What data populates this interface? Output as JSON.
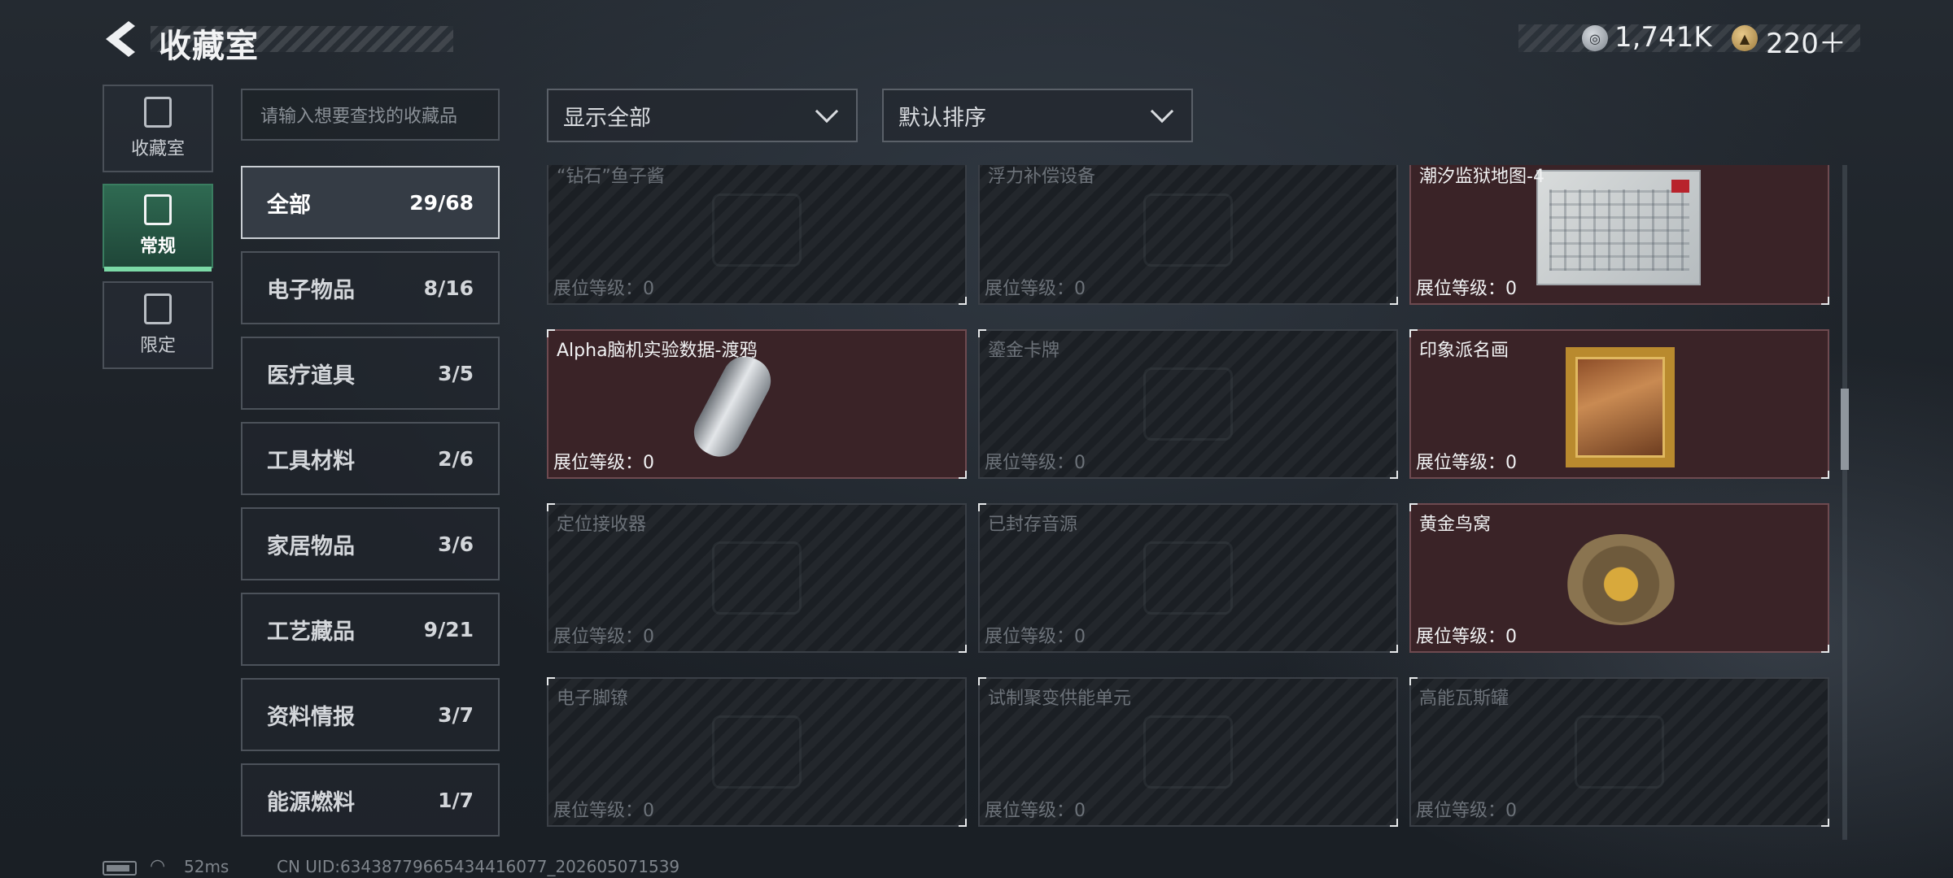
{
  "header": {
    "title": "收藏室"
  },
  "currency": [
    {
      "icon": "silver-coin-icon",
      "value": "1,741K"
    },
    {
      "icon": "gold-coin-icon",
      "value": "220＋"
    }
  ],
  "side_tabs": [
    {
      "label": "收藏室",
      "icon": "vault-icon"
    },
    {
      "label": "常规",
      "icon": "regular-collection-icon",
      "active": true
    },
    {
      "label": "限定",
      "icon": "limited-collection-icon"
    }
  ],
  "search": {
    "placeholder": "请输入想要查找的收藏品"
  },
  "filters": {
    "display": "显示全部",
    "sort": "默认排序"
  },
  "categories": [
    {
      "name": "全部",
      "count": "29/68",
      "active": true
    },
    {
      "name": "电子物品",
      "count": "8/16"
    },
    {
      "name": "医疗道具",
      "count": "3/5"
    },
    {
      "name": "工具材料",
      "count": "2/6"
    },
    {
      "name": "家居物品",
      "count": "3/6"
    },
    {
      "name": "工艺藏品",
      "count": "9/21"
    },
    {
      "name": "资料情报",
      "count": "3/7"
    },
    {
      "name": "能源燃料",
      "count": "1/7"
    }
  ],
  "items": [
    {
      "name": "“钻石”鱼子酱",
      "level": "展位等级：0",
      "owned": false
    },
    {
      "name": "浮力补偿设备",
      "level": "展位等级：0",
      "owned": false
    },
    {
      "name": "潮汐监狱地图-4",
      "level": "展位等级：0",
      "owned": true,
      "art": "map"
    },
    {
      "name": "Alpha脑机实验数据-渡鸦",
      "level": "展位等级：0",
      "owned": true,
      "art": "cylinder"
    },
    {
      "name": "鎏金卡牌",
      "level": "展位等级：0",
      "owned": false
    },
    {
      "name": "印象派名画",
      "level": "展位等级：0",
      "owned": true,
      "art": "painting"
    },
    {
      "name": "定位接收器",
      "level": "展位等级：0",
      "owned": false
    },
    {
      "name": "已封存音源",
      "level": "展位等级：0",
      "owned": false
    },
    {
      "name": "黄金鸟窝",
      "level": "展位等级：0",
      "owned": true,
      "art": "nest"
    },
    {
      "name": "电子脚镣",
      "level": "展位等级：0",
      "owned": false
    },
    {
      "name": "试制聚变供能单元",
      "level": "展位等级：0",
      "owned": false
    },
    {
      "name": "高能瓦斯罐",
      "level": "展位等级：0",
      "owned": false
    }
  ],
  "status_bar": {
    "ping": "52ms",
    "uid": "CN UID:63438779665434416077_202605071539"
  }
}
